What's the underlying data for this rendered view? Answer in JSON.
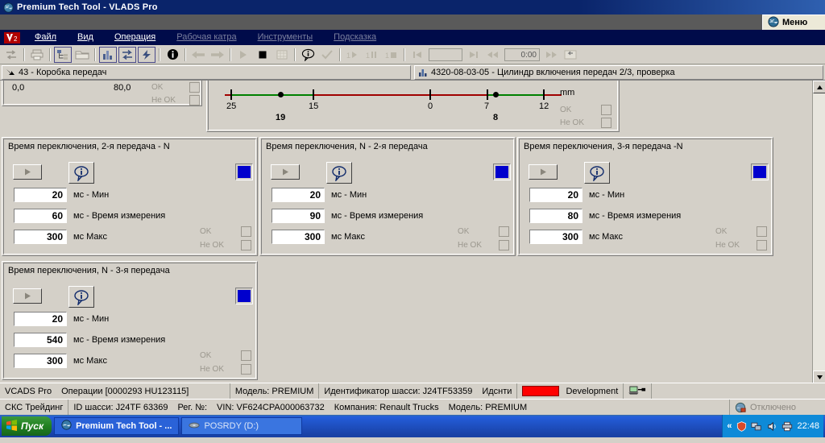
{
  "window": {
    "title": "Premium Tech Tool - VLADS Pro",
    "app_icon": "globe-icon",
    "menu_button_label": "Меню",
    "menu_button_icon": "globe-icon"
  },
  "menubar": {
    "logo": "V",
    "items": [
      {
        "label": "Файл",
        "enabled": true
      },
      {
        "label": "Вид",
        "enabled": true
      },
      {
        "label": "Операция",
        "enabled": true
      },
      {
        "label": "Рабочая катра",
        "enabled": false
      },
      {
        "label": "Инструменты",
        "enabled": false
      },
      {
        "label": "Подсказка",
        "enabled": false
      }
    ]
  },
  "toolbar": {
    "buttons": [
      {
        "name": "transfer-icon",
        "pressed": false,
        "enabled": false
      },
      {
        "name": "print-icon",
        "pressed": false,
        "enabled": false
      },
      {
        "name": "tree-view-icon",
        "pressed": true,
        "enabled": true
      },
      {
        "name": "folder-icon",
        "pressed": false,
        "enabled": false
      },
      {
        "name": "bar-chart-icon",
        "pressed": true,
        "enabled": true
      },
      {
        "name": "exchange-icon",
        "pressed": true,
        "enabled": true
      },
      {
        "name": "lightning-icon",
        "pressed": true,
        "enabled": true
      },
      {
        "name": "info-circle-icon",
        "pressed": false,
        "enabled": true
      },
      {
        "name": "arrow-left-icon",
        "pressed": false,
        "enabled": false
      },
      {
        "name": "arrow-right-icon",
        "pressed": false,
        "enabled": false
      },
      {
        "name": "play-icon",
        "pressed": false,
        "enabled": false
      },
      {
        "name": "stop-icon",
        "pressed": false,
        "enabled": true
      },
      {
        "name": "grid-icon",
        "pressed": false,
        "enabled": false
      },
      {
        "name": "speech-info-icon",
        "pressed": false,
        "enabled": true
      },
      {
        "name": "checkmark-icon",
        "pressed": false,
        "enabled": false
      },
      {
        "name": "step-play-icon",
        "pressed": false,
        "enabled": false
      },
      {
        "name": "step-pause-icon",
        "pressed": false,
        "enabled": false
      },
      {
        "name": "step-stop-icon",
        "pressed": false,
        "enabled": false
      },
      {
        "name": "skip-start-icon",
        "pressed": false,
        "enabled": false
      },
      {
        "name": "skip-end-icon",
        "pressed": false,
        "enabled": false
      },
      {
        "name": "rewind-icon",
        "pressed": false,
        "enabled": false
      },
      {
        "name": "fast-forward-icon",
        "pressed": false,
        "enabled": false
      },
      {
        "name": "loop-icon",
        "pressed": false,
        "enabled": false
      }
    ],
    "time_value": "0:00"
  },
  "tabs": [
    {
      "icon": "arrow-down-right-icon",
      "label": "43 - Коробка передач"
    },
    {
      "icon": "bar-chart-icon",
      "label": "4320-08-03-05 - Цилиндр включения передач 2/3, проверка"
    }
  ],
  "partial_panel": {
    "left_value": "0,0",
    "right_value": "80,0",
    "ok_label": "OK",
    "not_ok_label": "Не OK"
  },
  "gauge": {
    "unit": "mm",
    "ok_label": "OK",
    "not_ok_label": "Не OK",
    "ticks": [
      {
        "label": "25"
      },
      {
        "label": "15"
      },
      {
        "label": "0"
      },
      {
        "label": "7"
      },
      {
        "label": "12"
      }
    ],
    "markers": [
      {
        "value": "19"
      },
      {
        "value": "8"
      }
    ],
    "colors": {
      "green": "#008000",
      "red": "#a00000"
    }
  },
  "groups": [
    {
      "title": "Время переключения, 2-я передача - N",
      "min_value": "20",
      "min_label": "мс - Мин",
      "measured_value": "60",
      "measured_label": "мс - Время измерения",
      "max_value": "300",
      "max_label": "мс  Макс",
      "ok_label": "OK",
      "not_ok_label": "Не OK",
      "indicator_color": "#0000cd",
      "play_icon": "play-triangle-icon",
      "info_icon": "speech-info-icon"
    },
    {
      "title": "Время переключения, N - 2-я передача",
      "min_value": "20",
      "min_label": "мс - Мин",
      "measured_value": "90",
      "measured_label": "мс - Время измерения",
      "max_value": "300",
      "max_label": "мс  Макс",
      "ok_label": "OK",
      "not_ok_label": "Не OK",
      "indicator_color": "#0000cd",
      "play_icon": "play-triangle-icon",
      "info_icon": "speech-info-icon"
    },
    {
      "title": "Время переключения, 3-я передача -N",
      "min_value": "20",
      "min_label": "мс - Мин",
      "measured_value": "80",
      "measured_label": "мс - Время измерения",
      "max_value": "300",
      "max_label": "мс  Макс",
      "ok_label": "OK",
      "not_ok_label": "Не OK",
      "indicator_color": "#0000cd",
      "play_icon": "play-triangle-icon",
      "info_icon": "speech-info-icon"
    },
    {
      "title": "Время переключения, N - 3-я передача",
      "min_value": "20",
      "min_label": "мс - Мин",
      "measured_value": "540",
      "measured_label": "мс - Время измерения",
      "max_value": "300",
      "max_label": "мс  Макс",
      "ok_label": "OK",
      "not_ok_label": "Не OK",
      "indicator_color": "#0000cd",
      "play_icon": "play-triangle-icon",
      "info_icon": "speech-info-icon"
    }
  ],
  "status_top": {
    "app": "VCADS Pro",
    "operation": "Операции   [0000293 HU123115]",
    "model": "Модель: PREMIUM",
    "chassis": "Идентификатор шасси: J24TF53359",
    "ident": "Идснти",
    "build_label": "Development",
    "build_color": "#ff0000",
    "connection_icon": "computer-link-icon"
  },
  "status_bottom": {
    "dealer": "СКС Трейдинг",
    "chassis_id": "ID шасси: J24TF 63369",
    "reg_no": "Рег. №:",
    "vin": "VIN: VF624CPA000063732",
    "company": "Компания: Renault Trucks",
    "model": "Модель: PREMIUM",
    "connection_status": "Отключено",
    "connection_icon": "network-icon"
  },
  "taskbar": {
    "start_label": "Пуск",
    "start_icon": "windows-flag-icon",
    "items": [
      {
        "label": "Premium Tech Tool - ...",
        "icon": "globe-icon",
        "active": true
      },
      {
        "label": "POSRDY (D:)",
        "icon": "disc-icon",
        "active": false
      }
    ],
    "tray": {
      "chevrons": "«",
      "icons": [
        "shield-icon",
        "network-icon",
        "volume-icon",
        "printer-icon"
      ],
      "clock": "22:48"
    }
  }
}
